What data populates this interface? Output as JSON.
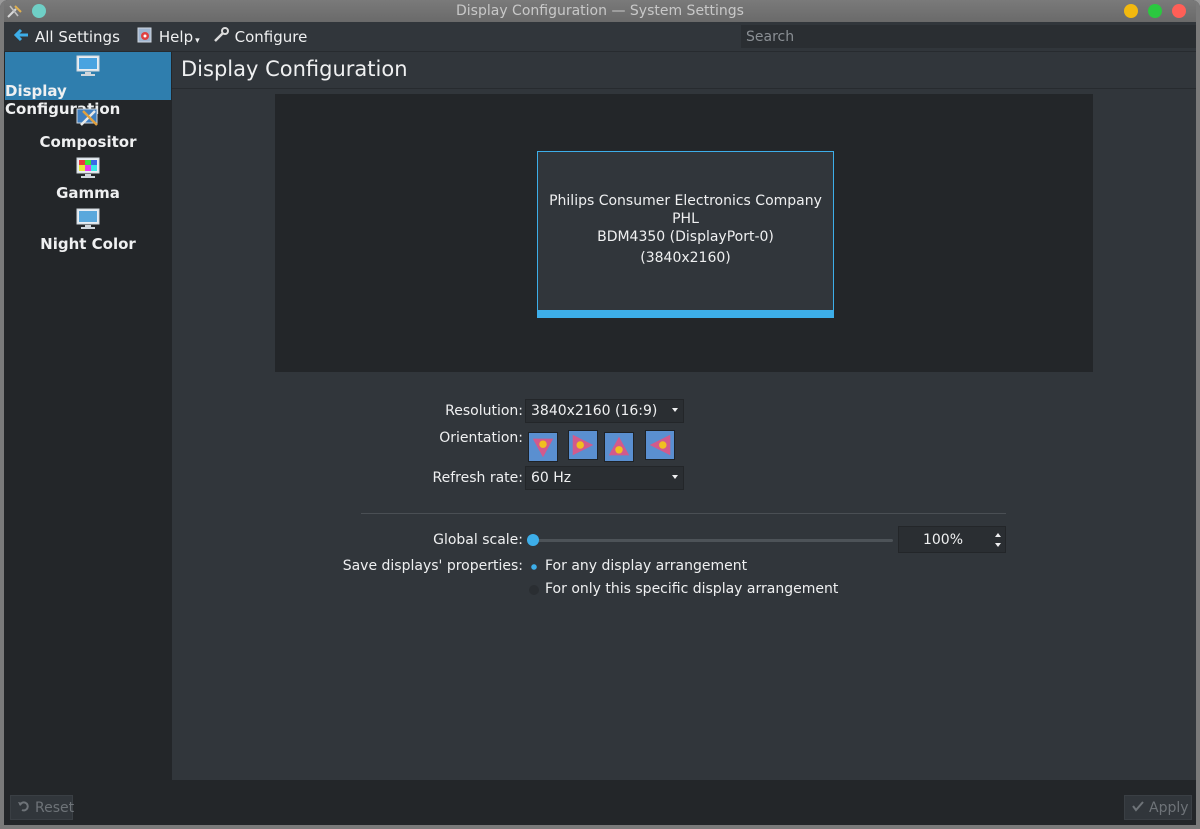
{
  "window": {
    "title": "Display Configuration — System Settings",
    "traffic_lights": [
      "#f2b90f",
      "#2bc840",
      "#ff5f57"
    ]
  },
  "toolbar": {
    "all_settings_label": "All Settings",
    "help_label": "Help",
    "configure_label": "Configure",
    "search_placeholder": "Search"
  },
  "sidebar": {
    "items": [
      {
        "label": "Display Configuration",
        "icon": "monitor-icon",
        "active": true
      },
      {
        "label": "Compositor",
        "icon": "compositor-icon",
        "active": false
      },
      {
        "label": "Gamma",
        "icon": "gamma-icon",
        "active": false
      },
      {
        "label": "Night Color",
        "icon": "night-color-icon",
        "active": false
      }
    ]
  },
  "main": {
    "page_title": "Display Configuration",
    "monitor": {
      "name_line1": "Philips Consumer Electronics Company PHL",
      "name_line2": "BDM4350 (DisplayPort-0)",
      "resolution": "(3840x2160)"
    },
    "resolution_label": "Resolution:",
    "resolution_value": "3840x2160 (16:9)",
    "orientation_label": "Orientation:",
    "refresh_label": "Refresh rate:",
    "refresh_value": "60 Hz",
    "scale_label": "Global scale:",
    "scale_value": "100%",
    "scale_level": 0.0,
    "save_label": "Save displays' properties:",
    "save_options": [
      {
        "label": "For any display arrangement",
        "checked": true
      },
      {
        "label": "For only this specific display arrangement",
        "checked": false
      }
    ]
  },
  "footer": {
    "reset_label": "Reset",
    "apply_label": "Apply"
  },
  "colors": {
    "accent": "#3daee9",
    "background": "#31363b",
    "sidebar": "#232629"
  }
}
